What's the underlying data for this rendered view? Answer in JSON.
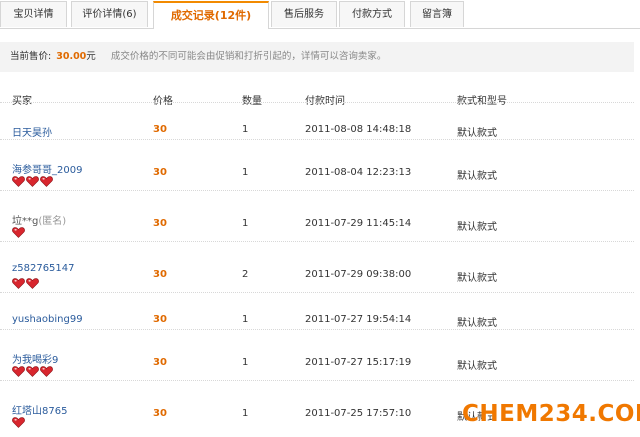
{
  "tabs": [
    {
      "label": "宝贝详情"
    },
    {
      "label": "评价详情(6)"
    },
    {
      "label": "成交记录(12件)"
    },
    {
      "label": "售后服务"
    },
    {
      "label": "付款方式"
    },
    {
      "label": "留言簿"
    }
  ],
  "price_bar": {
    "label": "当前售价:",
    "value": "30.00",
    "unit": "元",
    "note": "成交价格的不同可能会由促销和打折引起的，详情可以咨询卖家。"
  },
  "columns": {
    "buyer": "买家",
    "price": "价格",
    "qty": "数量",
    "time": "付款时间",
    "model": "款式和型号"
  },
  "rows": [
    {
      "buyer": "日天昊孙",
      "anon": "",
      "hearts": 0,
      "price": "30",
      "qty": "1",
      "time": "2011-08-08 14:48:18",
      "model": "默认款式"
    },
    {
      "buyer": "海参哥哥_2009",
      "anon": "",
      "hearts": 3,
      "price": "30",
      "qty": "1",
      "time": "2011-08-04 12:23:13",
      "model": "默认款式"
    },
    {
      "buyer": "垃**g",
      "anon": "(匿名)",
      "hearts": 1,
      "price": "30",
      "qty": "1",
      "time": "2011-07-29 11:45:14",
      "model": "默认款式"
    },
    {
      "buyer": "z582765147",
      "anon": "",
      "hearts": 2,
      "price": "30",
      "qty": "2",
      "time": "2011-07-29 09:38:00",
      "model": "默认款式"
    },
    {
      "buyer": "yushaobing99",
      "anon": "",
      "hearts": 0,
      "price": "30",
      "qty": "1",
      "time": "2011-07-27 19:54:14",
      "model": "默认款式"
    },
    {
      "buyer": "为我喝彩9",
      "anon": "",
      "hearts": 3,
      "price": "30",
      "qty": "1",
      "time": "2011-07-27 15:17:19",
      "model": "默认款式"
    },
    {
      "buyer": "红塔山8765",
      "anon": "",
      "hearts": 1,
      "price": "30",
      "qty": "1",
      "time": "2011-07-25 17:57:10",
      "model": "默认款式"
    }
  ],
  "watermark": "CHEM234.COM",
  "colors": {
    "accent": "#e06a00",
    "link": "#2a5b9c",
    "heart": "#d8262e"
  }
}
